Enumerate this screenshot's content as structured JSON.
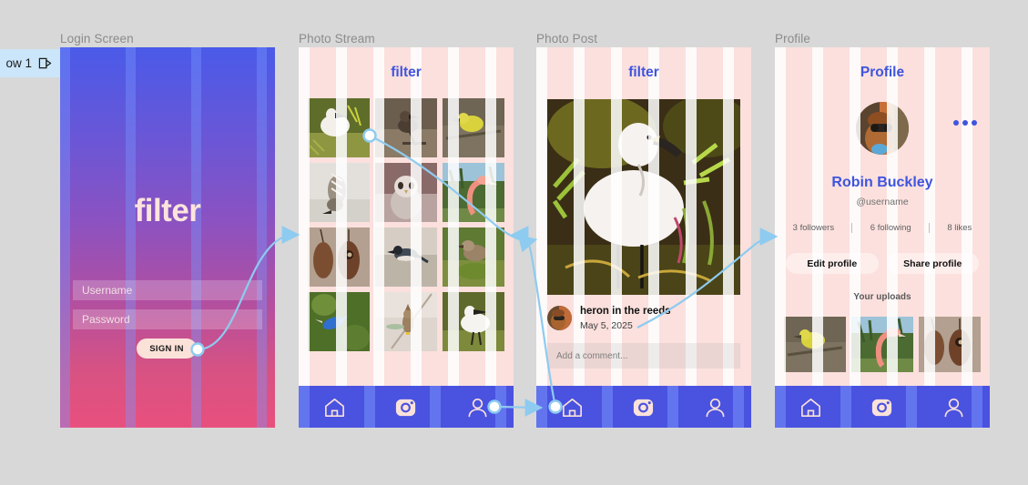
{
  "canvas": {
    "tab": {
      "label": "ow 1",
      "icon": "prototype-play-icon"
    },
    "accent_blue": "#3f54de",
    "proto_arrow_color": "#8ecbf0",
    "frame_title_color": "#8b8b8b"
  },
  "frames": [
    {
      "id": "login",
      "title": "Login Screen"
    },
    {
      "id": "stream",
      "title": "Photo Stream"
    },
    {
      "id": "post",
      "title": "Photo Post"
    },
    {
      "id": "profile",
      "title": "Profile"
    }
  ],
  "login_screen": {
    "logo": "filter",
    "username_placeholder": "Username",
    "password_placeholder": "Password",
    "signin_label": "SIGN IN"
  },
  "photo_stream": {
    "header": "filter",
    "nav": [
      "home-icon",
      "camera-icon",
      "profile-icon"
    ],
    "thumbnails": [
      "white-egret-on-branch",
      "kingfisher-on-perch",
      "yellow-warbler-on-branch",
      "woodpecker-in-snow",
      "snowy-owl",
      "flamingo-among-palms",
      "hanging-weaver-nests",
      "magpie-on-gravel",
      "sparrow-on-mossy-rock",
      "blue-jay-in-flight",
      "waxwing-on-wire",
      "snowy-egret-wading"
    ]
  },
  "photo_post": {
    "header": "filter",
    "hero_image": "white-heron-in-green-reeds",
    "avatar": "user-avatar-thumbnail",
    "caption": "heron in the reeds",
    "date": "May 5, 2025",
    "comment_placeholder": "Add a comment...",
    "nav": [
      "home-icon",
      "camera-icon",
      "profile-icon"
    ]
  },
  "profile": {
    "header": "Profile",
    "more_menu": "•••",
    "avatar": "person-with-binoculars",
    "name": "Robin Buckley",
    "handle": "@username",
    "stats": [
      {
        "value": "3 followers"
      },
      {
        "value": "6 following"
      },
      {
        "value": "8 likes"
      }
    ],
    "buttons": [
      {
        "label": "Edit profile"
      },
      {
        "label": "Share profile"
      }
    ],
    "uploads_label": "Your uploads",
    "uploads": [
      "yellow-warbler-on-branch",
      "flamingo-among-palms",
      "hanging-weaver-nests"
    ],
    "nav": [
      "home-icon",
      "camera-icon",
      "profile-icon"
    ]
  }
}
